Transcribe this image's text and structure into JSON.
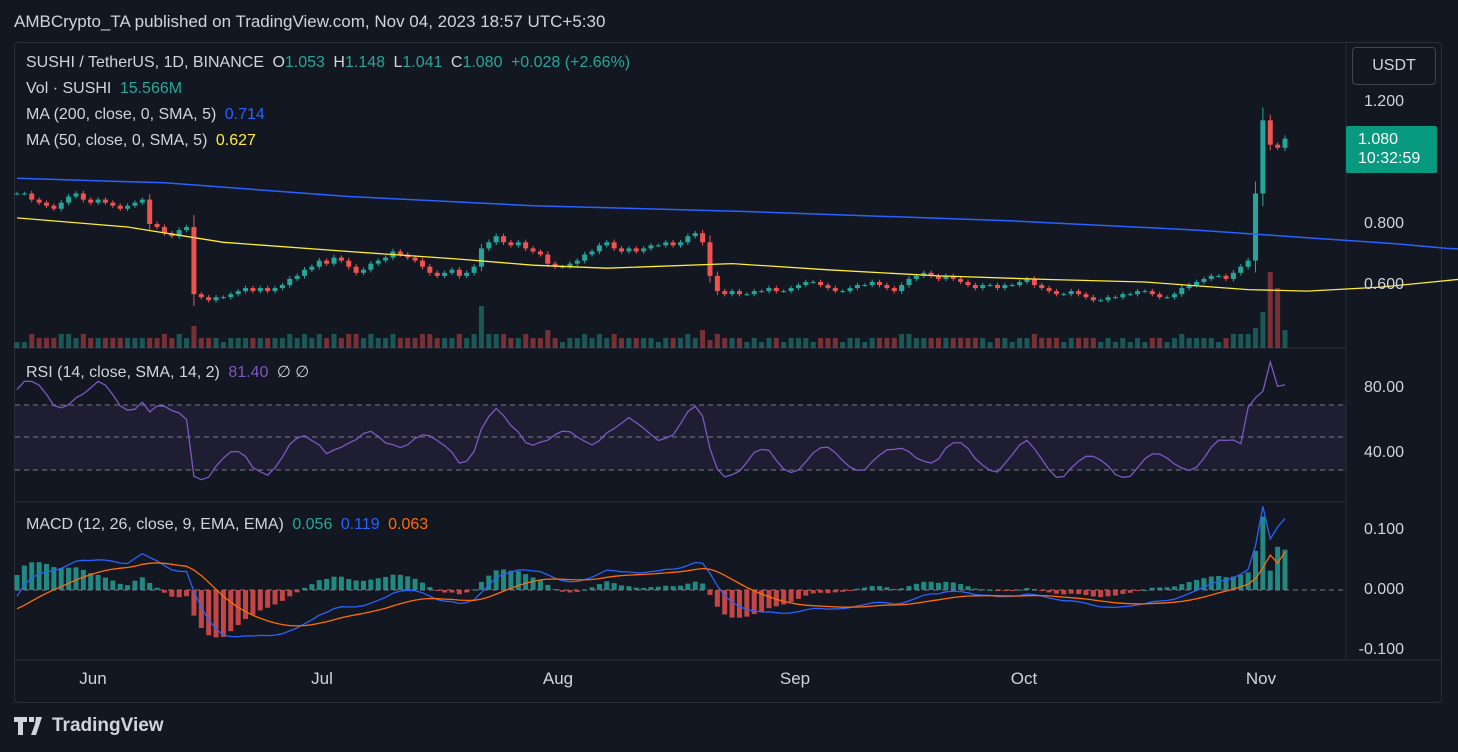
{
  "header": "AMBCrypto_TA published on TradingView.com, Nov 04, 2023 18:57 UTC+5:30",
  "currency_button": "USDT",
  "legend": {
    "symbol": "SUSHI / TetherUS, 1D, BINANCE",
    "o_label": "O",
    "o_value": "1.053",
    "h_label": "H",
    "h_value": "1.148",
    "l_label": "L",
    "l_value": "1.041",
    "c_label": "C",
    "c_value": "1.080",
    "change": "+0.028 (+2.66%)",
    "vol_label": "Vol · SUSHI",
    "vol_value": "15.566M",
    "ma200_label": "MA (200, close, 0, SMA, 5)",
    "ma200_value": "0.714",
    "ma50_label": "MA (50, close, 0, SMA, 5)",
    "ma50_value": "0.627",
    "rsi_label": "RSI (14, close, SMA, 14, 2)",
    "rsi_value": "81.40",
    "rsi_extra": "∅ ∅",
    "macd_label": "MACD (12, 26, close, 9, EMA, EMA)",
    "macd_hist": "0.056",
    "macd_line": "0.119",
    "macd_signal": "0.063"
  },
  "price_box": {
    "price": "1.080",
    "countdown": "10:32:59"
  },
  "price_axis": [
    "1.200",
    "0.800",
    "0.600"
  ],
  "rsi_axis": [
    "80.00",
    "40.00"
  ],
  "macd_axis": [
    "0.100",
    "0.000",
    "-0.100"
  ],
  "time_axis": [
    "Jun",
    "Jul",
    "Aug",
    "Sep",
    "Oct",
    "Nov"
  ],
  "footer": "TradingView",
  "colors": {
    "up": "#26a69a",
    "down": "#ef5350",
    "ma200": "#2962ff",
    "ma50": "#ffeb3b",
    "rsi": "#7e57c2",
    "macd": "#2962ff",
    "signal": "#ff6d00"
  },
  "chart_data": {
    "type": "candlestick",
    "ma200_points": [
      [
        0,
        0.95
      ],
      [
        20,
        0.935
      ],
      [
        45,
        0.89
      ],
      [
        70,
        0.86
      ],
      [
        100,
        0.84
      ],
      [
        135,
        0.81
      ],
      [
        160,
        0.78
      ],
      [
        175,
        0.755
      ],
      [
        187,
        0.735
      ],
      [
        194,
        0.72
      ],
      [
        199,
        0.714
      ]
    ],
    "ma50_points": [
      [
        0,
        0.82
      ],
      [
        15,
        0.79
      ],
      [
        28,
        0.74
      ],
      [
        45,
        0.71
      ],
      [
        60,
        0.685
      ],
      [
        70,
        0.665
      ],
      [
        80,
        0.655
      ],
      [
        97,
        0.67
      ],
      [
        110,
        0.65
      ],
      [
        125,
        0.63
      ],
      [
        140,
        0.618
      ],
      [
        153,
        0.61
      ],
      [
        167,
        0.585
      ],
      [
        175,
        0.58
      ],
      [
        185,
        0.593
      ],
      [
        192,
        0.61
      ],
      [
        199,
        0.627
      ]
    ],
    "closes": [
      0.9,
      0.9,
      0.88,
      0.87,
      0.86,
      0.85,
      0.87,
      0.89,
      0.9,
      0.88,
      0.87,
      0.88,
      0.87,
      0.86,
      0.85,
      0.86,
      0.87,
      0.88,
      0.8,
      0.79,
      0.77,
      0.76,
      0.78,
      0.79,
      0.57,
      0.56,
      0.55,
      0.56,
      0.56,
      0.57,
      0.58,
      0.59,
      0.58,
      0.59,
      0.58,
      0.59,
      0.6,
      0.62,
      0.63,
      0.65,
      0.66,
      0.68,
      0.67,
      0.69,
      0.68,
      0.66,
      0.64,
      0.65,
      0.67,
      0.68,
      0.69,
      0.71,
      0.7,
      0.69,
      0.68,
      0.66,
      0.64,
      0.63,
      0.64,
      0.65,
      0.63,
      0.64,
      0.66,
      0.72,
      0.74,
      0.76,
      0.74,
      0.73,
      0.74,
      0.72,
      0.71,
      0.7,
      0.67,
      0.66,
      0.66,
      0.67,
      0.68,
      0.7,
      0.71,
      0.73,
      0.74,
      0.72,
      0.71,
      0.72,
      0.71,
      0.72,
      0.73,
      0.73,
      0.74,
      0.73,
      0.74,
      0.76,
      0.77,
      0.74,
      0.63,
      0.58,
      0.57,
      0.58,
      0.57,
      0.57,
      0.58,
      0.58,
      0.59,
      0.58,
      0.58,
      0.59,
      0.6,
      0.61,
      0.61,
      0.6,
      0.59,
      0.58,
      0.58,
      0.59,
      0.6,
      0.6,
      0.61,
      0.6,
      0.59,
      0.58,
      0.6,
      0.62,
      0.63,
      0.64,
      0.63,
      0.62,
      0.63,
      0.62,
      0.61,
      0.6,
      0.59,
      0.6,
      0.6,
      0.59,
      0.6,
      0.6,
      0.61,
      0.62,
      0.6,
      0.59,
      0.58,
      0.57,
      0.57,
      0.58,
      0.57,
      0.56,
      0.55,
      0.55,
      0.56,
      0.56,
      0.57,
      0.57,
      0.58,
      0.58,
      0.57,
      0.56,
      0.56,
      0.57,
      0.59,
      0.6,
      0.61,
      0.62,
      0.63,
      0.63,
      0.62,
      0.64,
      0.66,
      0.68,
      0.9,
      1.14,
      1.06,
      1.05,
      1.08
    ]
  }
}
